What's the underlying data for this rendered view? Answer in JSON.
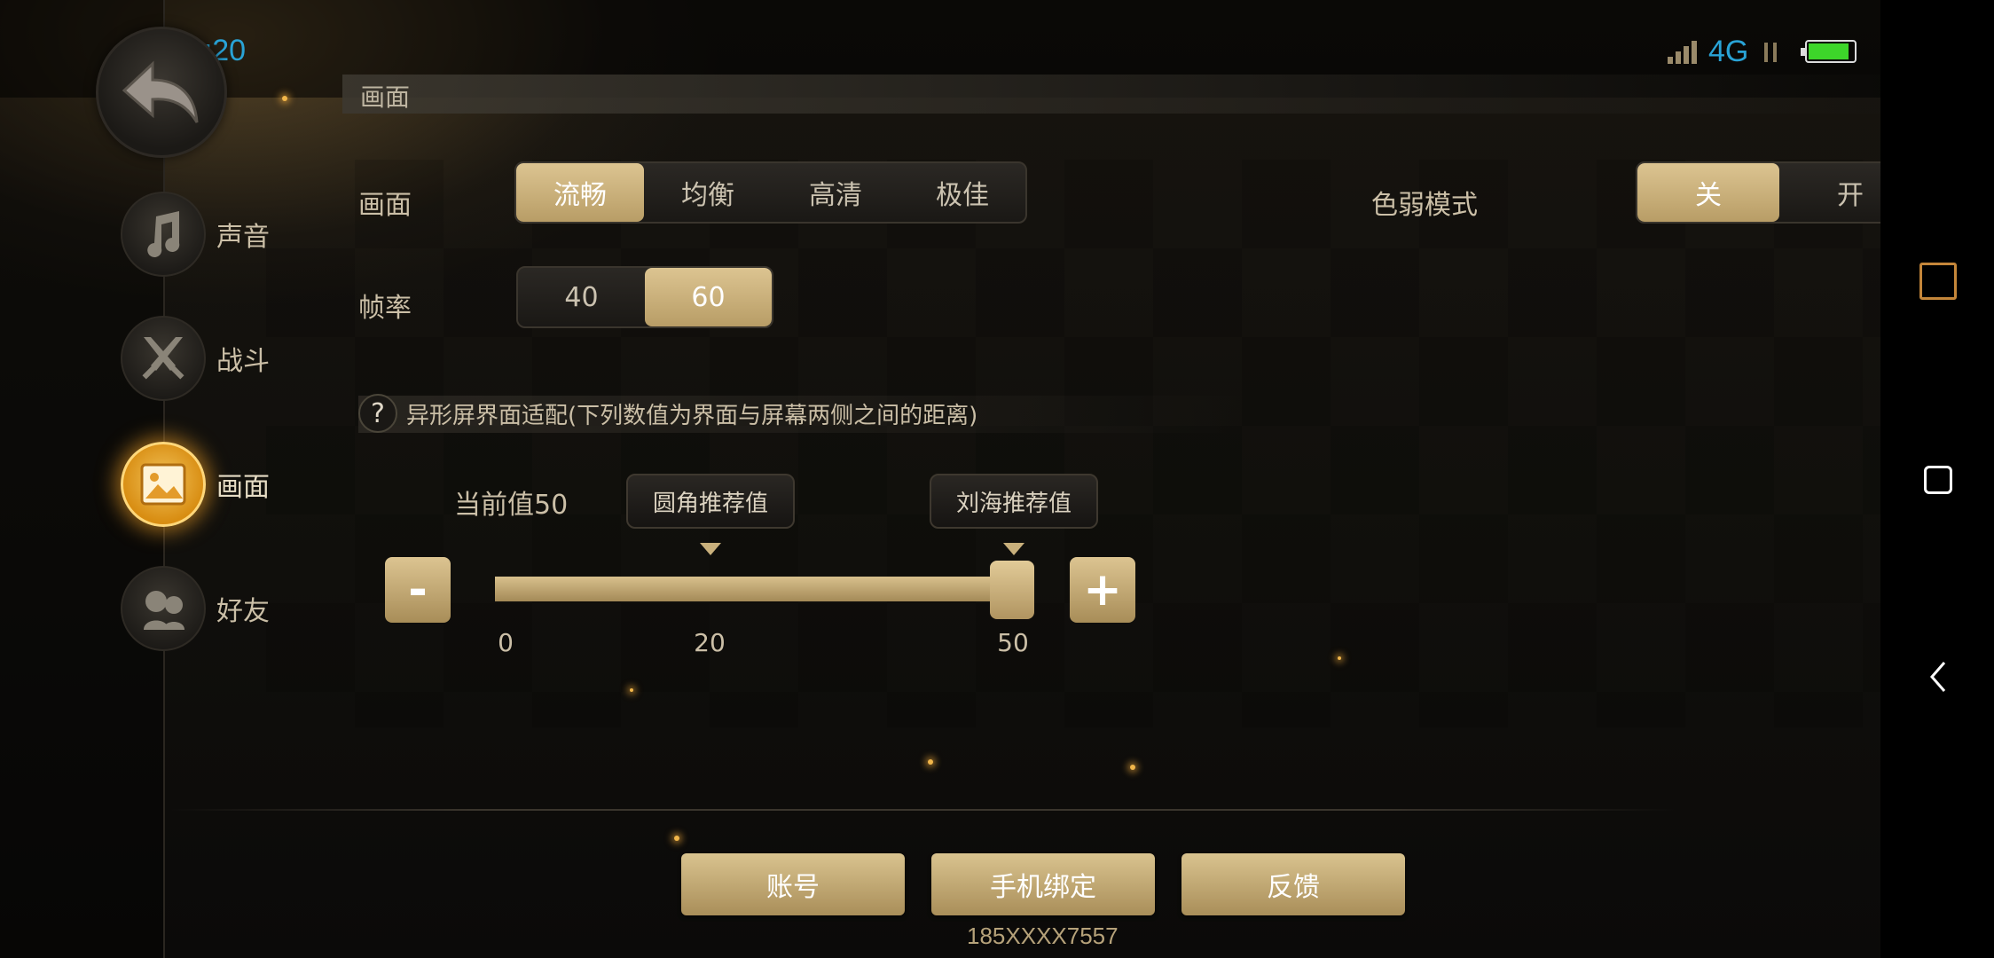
{
  "status_bar": {
    "time": "14:20",
    "network": "4G",
    "icons": [
      "signal-icon",
      "data-arrows-icon",
      "battery-icon"
    ],
    "battery_level": 0.9
  },
  "nav": {
    "items": [
      {
        "label": "声音",
        "icon": "music-note-icon",
        "active": false
      },
      {
        "label": "战斗",
        "icon": "crossed-swords-icon",
        "active": false
      },
      {
        "label": "画面",
        "icon": "picture-icon",
        "active": true
      },
      {
        "label": "好友",
        "icon": "friends-icon",
        "active": false
      }
    ]
  },
  "section_title": "画面",
  "graphics": {
    "label": "画面",
    "options": [
      "流畅",
      "均衡",
      "高清",
      "极佳"
    ],
    "selected": "流畅"
  },
  "colorblind": {
    "label": "色弱模式",
    "options": [
      "关",
      "开"
    ],
    "selected": "关"
  },
  "framerate": {
    "label": "帧率",
    "options": [
      "40",
      "60"
    ],
    "selected": "60"
  },
  "notch": {
    "hint": "异形屏界面适配(下列数值为界面与屏幕两侧之间的距离)",
    "help_symbol": "?",
    "current_value_text": "当前值50",
    "value": 50,
    "min": 0,
    "max": 50,
    "preset_round": "圆角推荐值",
    "preset_notch": "刘海推荐值",
    "tick_labels": [
      "0",
      "20",
      "50"
    ],
    "minus": "-",
    "plus": "+"
  },
  "bottom": {
    "account": "账号",
    "phone_bind": "手机绑定",
    "feedback": "反馈",
    "phone_number": "185XXXX7557"
  },
  "colors": {
    "accent_gold": "#c9b07c",
    "status_blue": "#29a3d6",
    "active_orange": "#e8a222"
  }
}
